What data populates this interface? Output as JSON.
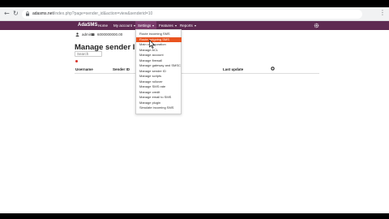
{
  "browser": {
    "url_host": "adasms.net",
    "url_path": "/index.php?page=sender_id&action=view&senderid=10"
  },
  "navbar": {
    "brand": "AdaSMS",
    "items": [
      {
        "label": "Home",
        "has_caret": false
      },
      {
        "label": "My account",
        "has_caret": true
      },
      {
        "label": "Settings",
        "has_caret": true
      },
      {
        "label": "Features",
        "has_caret": true
      },
      {
        "label": "Reports",
        "has_caret": true
      }
    ]
  },
  "user": {
    "name": "admin",
    "phone": "6000000000.00"
  },
  "page": {
    "title": "Manage sender ID",
    "search_placeholder": "Search",
    "columns": [
      "Username",
      "Sender ID",
      "Last update"
    ]
  },
  "dropdown": {
    "items": [
      "Route incoming SMS",
      "Route outgoing SMS",
      "Main configuration",
      "Manage ACL",
      "Manage account",
      "Manage firewall",
      "Manage gateway and SMSC",
      "Manage sender ID",
      "Manage scripts",
      "Manage rollover",
      "Manage SMS rate",
      "Manage credit",
      "Manage email to SMS",
      "Manage plugin",
      "Simulate incoming SMS"
    ],
    "highlighted_index": 1
  },
  "colors": {
    "navbar": "#5e2a52",
    "highlight": "#e95420"
  }
}
